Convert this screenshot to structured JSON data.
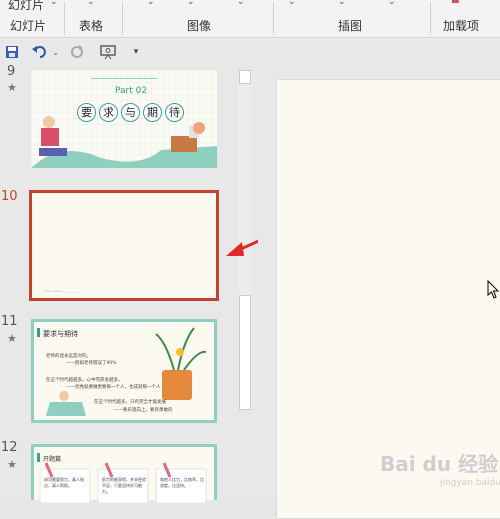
{
  "ribbon": {
    "groups": [
      {
        "top": "幻灯片",
        "label": "幻灯片"
      },
      {
        "label": "表格"
      },
      {
        "label": "图像"
      },
      {
        "label": "插图"
      },
      {
        "label": "加载项"
      }
    ]
  },
  "qat": {
    "save_icon": "save-icon",
    "undo_icon": "undo-icon",
    "redo_icon": "redo-icon",
    "present_icon": "present-icon",
    "customize_icon": "chevron-down-icon"
  },
  "slides": [
    {
      "number": "9",
      "star": "★"
    },
    {
      "number": "10",
      "star": ""
    },
    {
      "number": "11",
      "star": "★"
    },
    {
      "number": "12",
      "star": "★"
    }
  ],
  "slide9": {
    "part": "Part 02",
    "title_chars": [
      "要",
      "求",
      "与",
      "期",
      "待"
    ]
  },
  "slide10": {
    "footer": "https://www.___________"
  },
  "slide11": {
    "heading": "要求与期待",
    "lines": [
      "老师的话永远是对的。",
      "——假如老师错误了90%",
      "在这个时代越越多。心中完获会越多。",
      "——优秀就要做更要每一个人，也成就每一个人",
      "在这个时代越多，只有完全才能发展",
      "——要乐观向上，要有勇敢的"
    ]
  },
  "slide12": {
    "heading": "开题篇",
    "cols": [
      "成功需要努力，真人指点，真人帮助。",
      "努力的能获得，并非经验不足，只要坚持学习能力。",
      "和他人比力，比效率，比态度，比坚持。"
    ]
  },
  "watermark": {
    "text": "Bai du 经验",
    "sub": "jingyan.baidu.com"
  },
  "colors": {
    "accent": "#c0442d",
    "teal": "#8fcfc0",
    "arrow": "#e02a2a"
  }
}
